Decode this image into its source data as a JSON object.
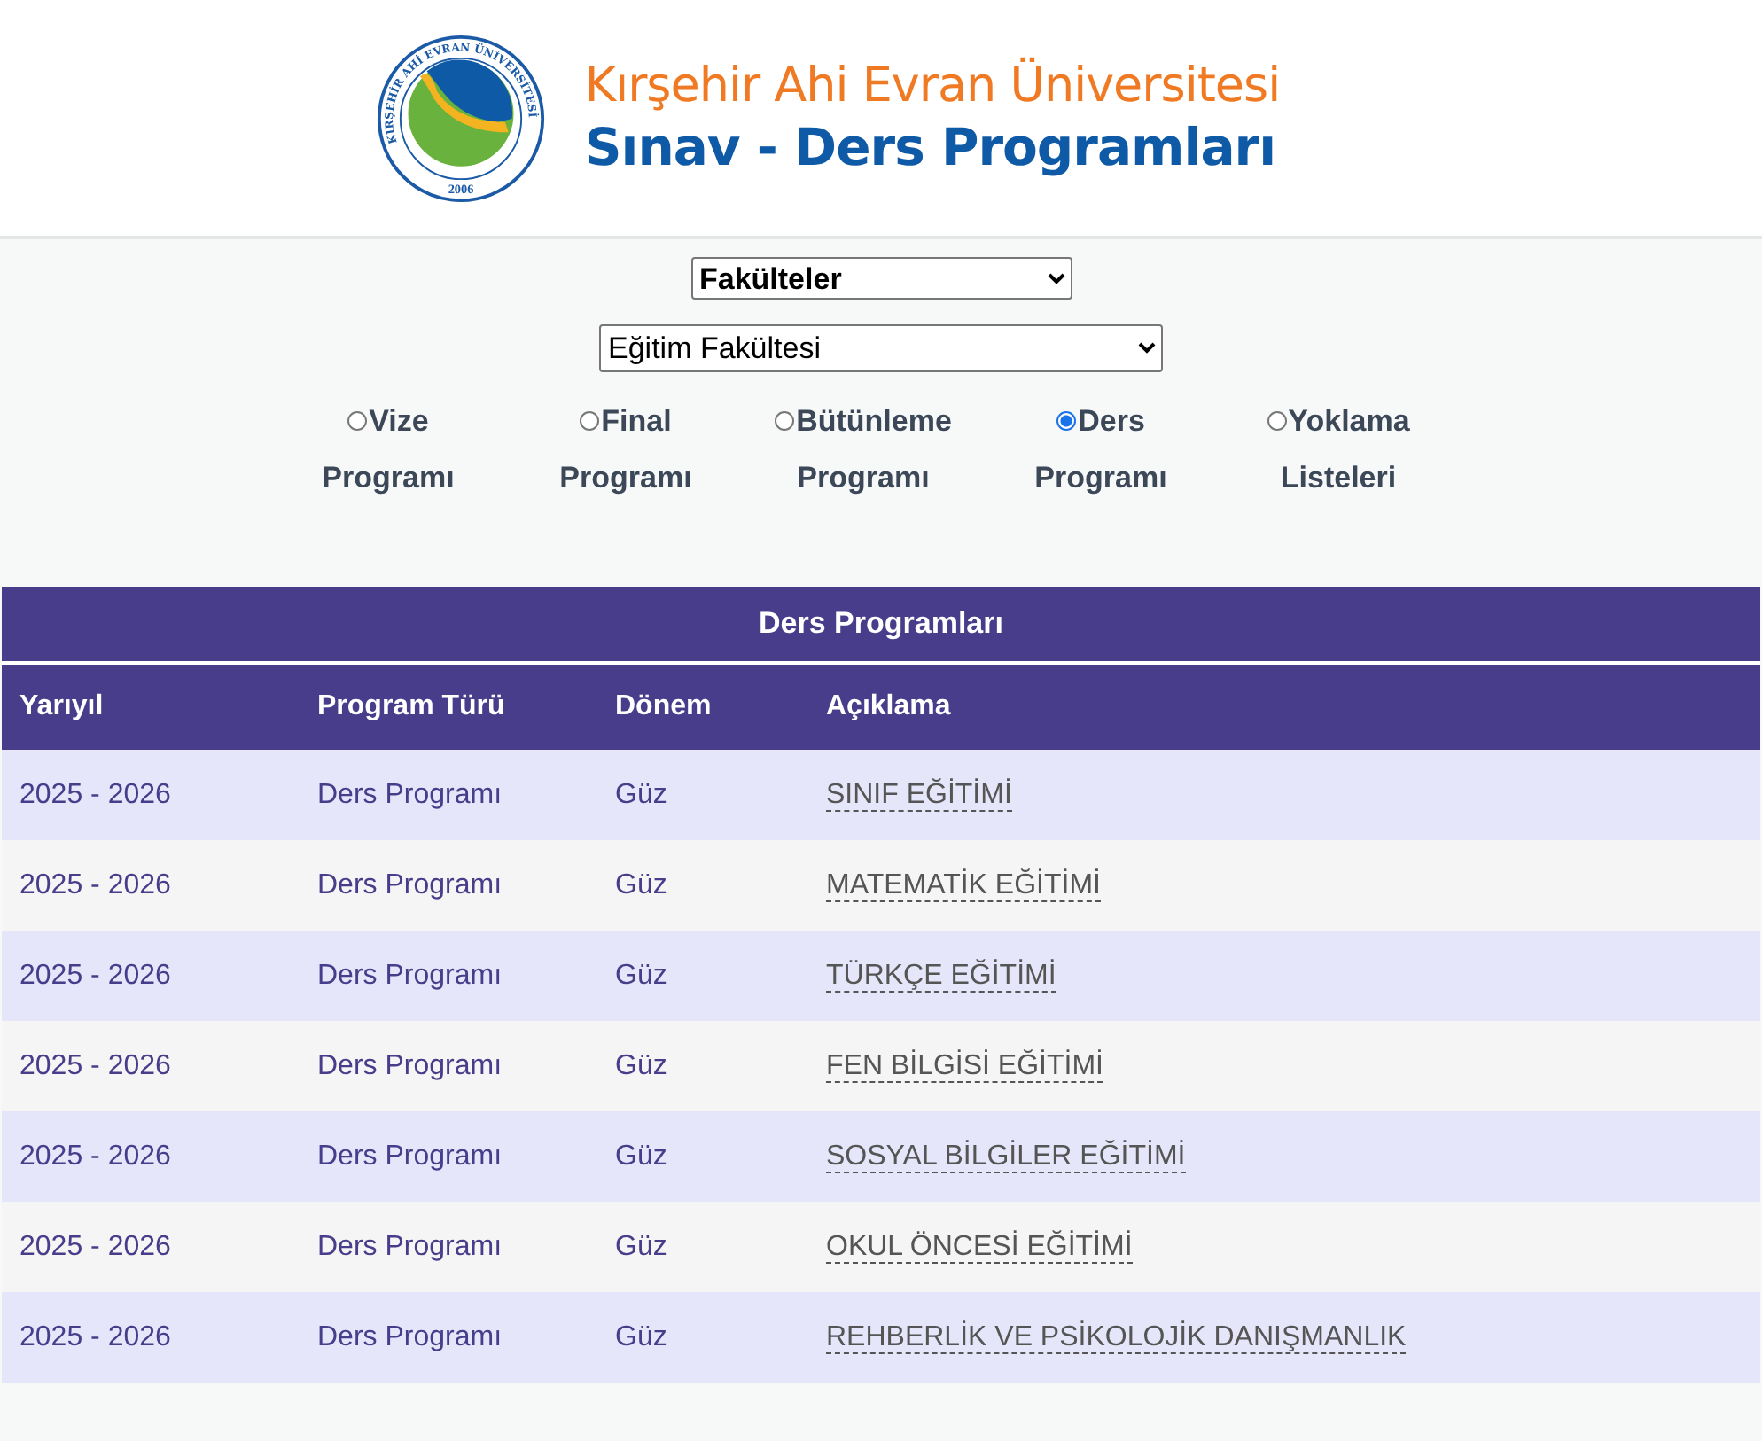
{
  "header": {
    "seal_text": "KIRŞEHİR AHİ EVRAN ÜNİVERSİTESİ",
    "seal_year": "2006",
    "university": "Kırşehir Ahi Evran Üniversitesi",
    "title": "Sınav - Ders Programları"
  },
  "filters": {
    "category": "Fakülteler",
    "unit": "Eğitim Fakültesi"
  },
  "program_types": [
    {
      "label": "Vize Programı",
      "selected": false
    },
    {
      "label": "Final Programı",
      "selected": false
    },
    {
      "label": "Bütünleme Programı",
      "selected": false
    },
    {
      "label": "Ders Programı",
      "selected": true
    },
    {
      "label": "Yoklama Listeleri",
      "selected": false
    }
  ],
  "table": {
    "title": "Ders Programları",
    "columns": [
      "Yarıyıl",
      "Program Türü",
      "Dönem",
      "Açıklama"
    ],
    "rows": [
      [
        "2025 - 2026",
        "Ders Programı",
        "Güz",
        "SINIF EĞİTİMİ"
      ],
      [
        "2025 - 2026",
        "Ders Programı",
        "Güz",
        "MATEMATİK EĞİTİMİ"
      ],
      [
        "2025 - 2026",
        "Ders Programı",
        "Güz",
        "TÜRKÇE EĞİTİMİ"
      ],
      [
        "2025 - 2026",
        "Ders Programı",
        "Güz",
        "FEN BİLGİSİ EĞİTİMİ"
      ],
      [
        "2025 - 2026",
        "Ders Programı",
        "Güz",
        "SOSYAL BİLGİLER EĞİTİMİ"
      ],
      [
        "2025 - 2026",
        "Ders Programı",
        "Güz",
        "OKUL ÖNCESİ EĞİTİMİ"
      ],
      [
        "2025 - 2026",
        "Ders Programı",
        "Güz",
        "REHBERLİK VE PSİKOLOJİK DANIŞMANLIK"
      ]
    ]
  }
}
